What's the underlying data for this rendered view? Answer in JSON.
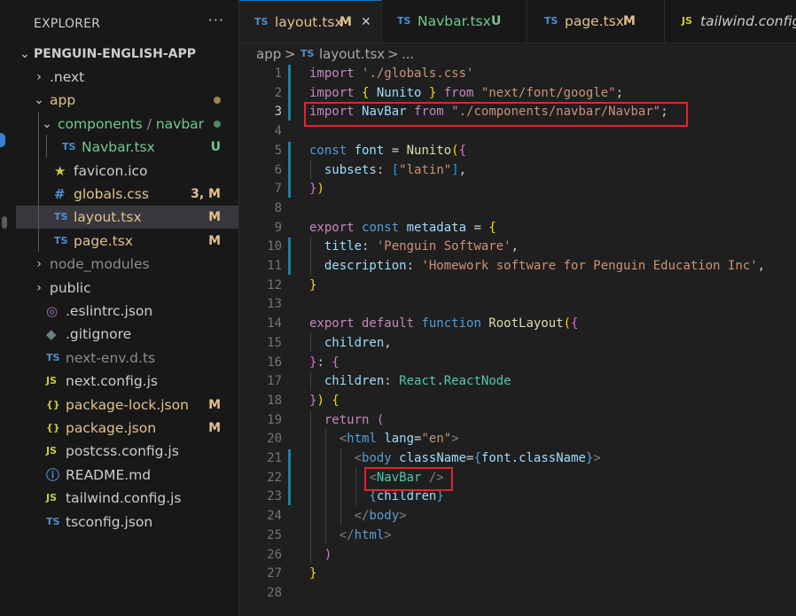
{
  "explorer": {
    "header": "EXPLORER",
    "more": "···",
    "project": "PENGUIN-ENGLISH-APP",
    "items": [
      {
        "name": ".next",
        "kind": "folder-closed",
        "color": "#cccccc"
      },
      {
        "name": "app",
        "kind": "folder-open",
        "color": "#e2c08d"
      },
      {
        "name": "components",
        "sep": "/",
        "name2": "navbar",
        "kind": "folder-open",
        "color": "#73c991"
      },
      {
        "name": "Navbar.tsx",
        "icon": "TS",
        "badge": "U",
        "color": "#73c991"
      },
      {
        "name": "favicon.ico",
        "icon": "★",
        "color": "#cccccc"
      },
      {
        "name": "globals.css",
        "icon": "#",
        "badge": "3, M",
        "color": "#e2c08d"
      },
      {
        "name": "layout.tsx",
        "icon": "TS",
        "badge": "M",
        "color": "#e2c08d"
      },
      {
        "name": "page.tsx",
        "icon": "TS",
        "badge": "M",
        "color": "#e2c08d"
      },
      {
        "name": "node_modules",
        "kind": "folder-closed",
        "color": "#8c8c8c"
      },
      {
        "name": "public",
        "kind": "folder-closed",
        "color": "#cccccc"
      },
      {
        "name": ".eslintrc.json",
        "icon": "◎",
        "color": "#cccccc"
      },
      {
        "name": ".gitignore",
        "icon": "◆",
        "color": "#cccccc"
      },
      {
        "name": "next-env.d.ts",
        "icon": "TS",
        "color": "#8c8c8c"
      },
      {
        "name": "next.config.js",
        "icon": "JS",
        "color": "#cccccc"
      },
      {
        "name": "package-lock.json",
        "icon": "{}",
        "badge": "M",
        "color": "#e2c08d"
      },
      {
        "name": "package.json",
        "icon": "{}",
        "badge": "M",
        "color": "#e2c08d"
      },
      {
        "name": "postcss.config.js",
        "icon": "JS",
        "color": "#cccccc"
      },
      {
        "name": "README.md",
        "icon": "ⓘ",
        "color": "#cccccc"
      },
      {
        "name": "tailwind.config.js",
        "icon": "JS",
        "color": "#cccccc"
      },
      {
        "name": "tsconfig.json",
        "icon": "TS",
        "color": "#cccccc"
      }
    ]
  },
  "tabs": [
    {
      "icon": "TS",
      "label": "layout.tsx",
      "badge": "M",
      "close": "✕"
    },
    {
      "icon": "TS",
      "label": "Navbar.tsx",
      "badge": "U"
    },
    {
      "icon": "TS",
      "label": "page.tsx",
      "badge": "M"
    },
    {
      "icon": "JS",
      "label": "tailwind.config.js"
    }
  ],
  "breadcrumb": {
    "part1": "app",
    "sep1": ">",
    "icon": "TS",
    "part2": "layout.tsx",
    "sep2": ">",
    "ellipsis": "..."
  },
  "editor": {
    "line_numbers": [
      "1",
      "2",
      "3",
      "4",
      "5",
      "6",
      "7",
      "8",
      "9",
      "10",
      "11",
      "12",
      "13",
      "14",
      "15",
      "16",
      "17",
      "18",
      "19",
      "20",
      "21",
      "22",
      "23",
      "24",
      "25",
      "26",
      "27",
      "28"
    ],
    "current_line": "3",
    "lines": [
      [
        [
          "k",
          "import "
        ],
        [
          "s",
          "'./globals.css'"
        ]
      ],
      [
        [
          "k",
          "import "
        ],
        [
          "y",
          "{ "
        ],
        [
          "v",
          "Nunito "
        ],
        [
          "y",
          "}"
        ],
        [
          "k",
          " from "
        ],
        [
          "s",
          "\"next/font/google\""
        ],
        [
          "w",
          ";"
        ]
      ],
      [
        [
          "k",
          "import "
        ],
        [
          "v",
          "NavBar"
        ],
        [
          "k",
          " from "
        ],
        [
          "s",
          "\"./components/navbar/Navbar\""
        ],
        [
          "w",
          ";"
        ]
      ],
      [],
      [
        [
          "b",
          "const "
        ],
        [
          "v",
          "font"
        ],
        [
          "w",
          " = "
        ],
        [
          "f",
          "Nunito"
        ],
        [
          "y",
          "("
        ],
        [
          "p",
          "{"
        ]
      ],
      [
        [
          "w",
          "  "
        ],
        [
          "v",
          "subsets"
        ],
        [
          "w",
          ": "
        ],
        [
          "bl",
          "["
        ],
        [
          "s",
          "\"latin\""
        ],
        [
          "bl",
          "]"
        ],
        [
          "w",
          ","
        ]
      ],
      [
        [
          "p",
          "}"
        ],
        [
          "y",
          ")"
        ]
      ],
      [],
      [
        [
          "k",
          "export "
        ],
        [
          "b",
          "const "
        ],
        [
          "v",
          "metadata"
        ],
        [
          "w",
          " = "
        ],
        [
          "y",
          "{"
        ]
      ],
      [
        [
          "w",
          "  "
        ],
        [
          "v",
          "title"
        ],
        [
          "w",
          ": "
        ],
        [
          "s",
          "'Penguin Software'"
        ],
        [
          "w",
          ","
        ]
      ],
      [
        [
          "w",
          "  "
        ],
        [
          "v",
          "description"
        ],
        [
          "w",
          ": "
        ],
        [
          "s",
          "'Homework software for Penguin Education Inc'"
        ],
        [
          "w",
          ","
        ]
      ],
      [
        [
          "y",
          "}"
        ]
      ],
      [],
      [
        [
          "k",
          "export default "
        ],
        [
          "b",
          "function "
        ],
        [
          "f",
          "RootLayout"
        ],
        [
          "y",
          "("
        ],
        [
          "p",
          "{"
        ]
      ],
      [
        [
          "w",
          "  "
        ],
        [
          "v",
          "children"
        ],
        [
          "w",
          ","
        ]
      ],
      [
        [
          "p",
          "}"
        ],
        [
          "w",
          ": "
        ],
        [
          "p",
          "{"
        ]
      ],
      [
        [
          "w",
          "  "
        ],
        [
          "v",
          "children"
        ],
        [
          "w",
          ": "
        ],
        [
          "t",
          "React"
        ],
        [
          "w",
          "."
        ],
        [
          "t",
          "ReactNode"
        ]
      ],
      [
        [
          "p",
          "}"
        ],
        [
          "y",
          ")"
        ],
        [
          "w",
          " "
        ],
        [
          "y",
          "{"
        ]
      ],
      [
        [
          "w",
          "  "
        ],
        [
          "k",
          "return "
        ],
        [
          "p",
          "("
        ]
      ],
      [
        [
          "w",
          "    "
        ],
        [
          "g",
          "<"
        ],
        [
          "b",
          "html "
        ],
        [
          "v",
          "lang"
        ],
        [
          "w",
          "="
        ],
        [
          "s",
          "\"en\""
        ],
        [
          "g",
          ">"
        ]
      ],
      [
        [
          "w",
          "      "
        ],
        [
          "g",
          "<"
        ],
        [
          "b",
          "body "
        ],
        [
          "v",
          "className"
        ],
        [
          "w",
          "="
        ],
        [
          "b",
          "{"
        ],
        [
          "v",
          "font"
        ],
        [
          "w",
          "."
        ],
        [
          "v",
          "className"
        ],
        [
          "b",
          "}"
        ],
        [
          "g",
          ">"
        ]
      ],
      [
        [
          "w",
          "        "
        ],
        [
          "g",
          "<"
        ],
        [
          "t",
          "NavBar"
        ],
        [
          "g",
          " />"
        ]
      ],
      [
        [
          "w",
          "        "
        ],
        [
          "b",
          "{"
        ],
        [
          "v",
          "children"
        ],
        [
          "b",
          "}"
        ]
      ],
      [
        [
          "w",
          "      "
        ],
        [
          "g",
          "</"
        ],
        [
          "b",
          "body"
        ],
        [
          "g",
          ">"
        ]
      ],
      [
        [
          "w",
          "    "
        ],
        [
          "g",
          "</"
        ],
        [
          "b",
          "html"
        ],
        [
          "g",
          ">"
        ]
      ],
      [
        [
          "w",
          "  "
        ],
        [
          "p",
          ")"
        ]
      ],
      [
        [
          "y",
          "}"
        ]
      ],
      []
    ]
  }
}
